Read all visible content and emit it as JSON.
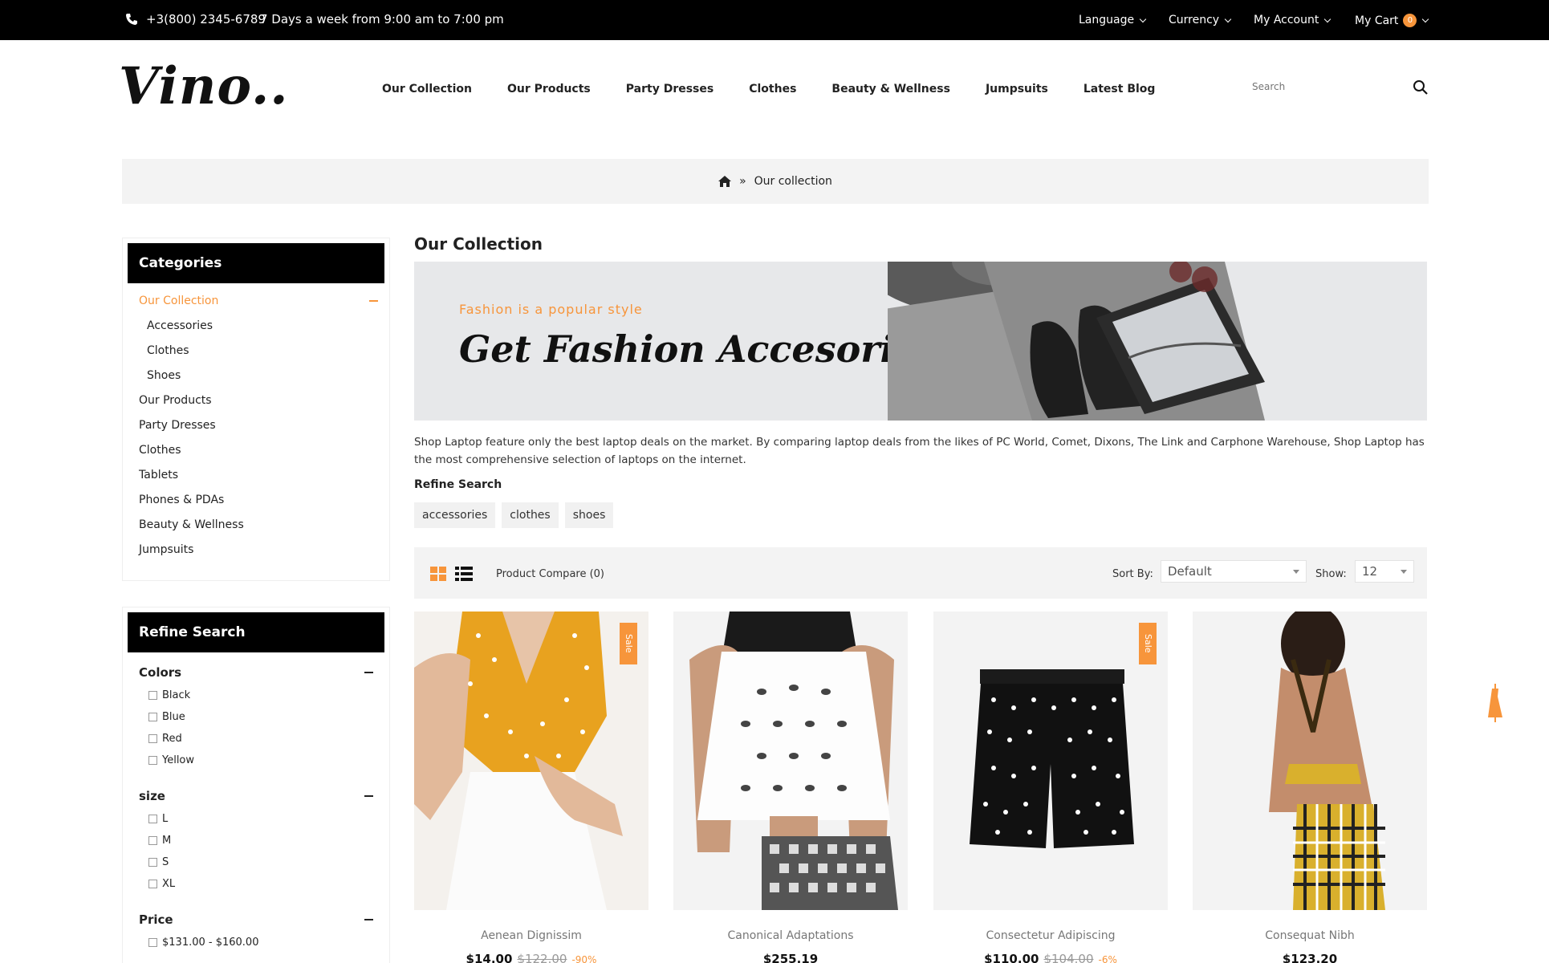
{
  "topbar": {
    "phone": "+3(800) 2345-6789",
    "hours": "7 Days a week from 9:00 am to 7:00 pm",
    "language": "Language",
    "currency": "Currency",
    "account": "My Account",
    "cart": "My Cart",
    "cart_count": "0"
  },
  "header": {
    "logo": "Vino..",
    "nav": [
      "Our Collection",
      "Our Products",
      "Party Dresses",
      "Clothes",
      "Beauty & Wellness",
      "Jumpsuits",
      "Latest Blog"
    ],
    "search_placeholder": "Search"
  },
  "breadcrumb": {
    "separator": "»",
    "current": "Our collection"
  },
  "sidebar": {
    "categories_title": "Categories",
    "active": "Our Collection",
    "sub_items": [
      "Accessories",
      "Clothes",
      "Shoes"
    ],
    "items": [
      "Our Products",
      "Party Dresses",
      "Clothes",
      "Tablets",
      "Phones & PDAs",
      "Beauty & Wellness",
      "Jumpsuits"
    ],
    "refine_title": "Refine Search",
    "colors_title": "Colors",
    "colors": [
      "Black",
      "Blue",
      "Red",
      "Yellow"
    ],
    "size_title": "size",
    "sizes": [
      "L",
      "M",
      "S",
      "XL"
    ],
    "price_title": "Price",
    "prices": [
      "$131.00 - $160.00"
    ]
  },
  "main": {
    "title": "Our Collection",
    "banner_sub": "Fashion is a popular style",
    "banner_title": "Get Fashion Accesories",
    "description": "Shop Laptop feature only the best laptop deals on the market. By comparing laptop deals from the likes of PC World, Comet, Dixons, The Link and Carphone Warehouse, Shop Laptop has the most comprehensive selection of laptops on the internet.",
    "refine_label": "Refine Search",
    "tags": [
      "accessories",
      "clothes",
      "shoes"
    ],
    "compare": "Product Compare (0)",
    "sort_label": "Sort By:",
    "sort_value": "Default",
    "show_label": "Show:",
    "show_value": "12"
  },
  "products": [
    {
      "name": "Aenean Dignissim",
      "price": "$14.00",
      "old": "$122.00",
      "disc": "-90%",
      "sale": "Sale"
    },
    {
      "name": "Canonical Adaptations",
      "price": "$255.19",
      "old": "",
      "disc": "",
      "sale": ""
    },
    {
      "name": "Consectetur Adipiscing",
      "price": "$110.00",
      "old": "$104.00",
      "disc": "-6%",
      "sale": "Sale"
    },
    {
      "name": "Consequat Nibh",
      "price": "$123.20",
      "old": "",
      "disc": "",
      "sale": ""
    }
  ],
  "colors": {
    "accent": "#f7953b",
    "topbar": "#000000",
    "panel": "#f3f3f3"
  }
}
